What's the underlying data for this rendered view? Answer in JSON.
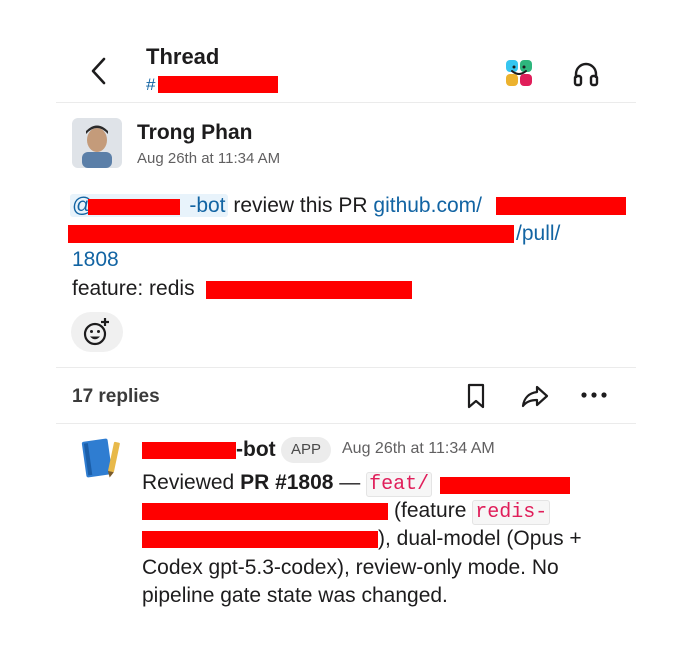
{
  "header": {
    "title": "Thread",
    "channel_prefix": "#"
  },
  "message": {
    "author": "Trong Phan",
    "timestamp": "Aug 26th at 11:34 AM",
    "mention_prefix": "@",
    "mention_suffix": "-bot",
    "text_review": " review this PR ",
    "link_start": "github.com/",
    "link_pull": "/pull/",
    "link_number": "1808",
    "feature_prefix": "feature: redis"
  },
  "thread": {
    "replies_label": "17 replies"
  },
  "reply": {
    "bot_name_suffix": "-bot",
    "badge": "APP",
    "timestamp": "Aug 26th at 11:34 AM",
    "line1_prefix": "Reviewed ",
    "line1_bold": "PR #1808",
    "line1_dash": " — ",
    "line1_code": "feat/",
    "line2_text": " (feature ",
    "line2_code": "redis-",
    "line3_text": "), dual-model (Opus +",
    "line4_text": "Codex gpt-5.3-codex), review-only mode. No",
    "line5_text": "pipeline gate state was changed."
  },
  "colors": {
    "link": "#1264a3",
    "code": "#e01e5a",
    "redaction": "#ff0000"
  },
  "icons": [
    "back-icon",
    "slack-logo-icon",
    "headphones-icon",
    "add-reaction-icon",
    "bookmark-icon",
    "share-icon",
    "more-icon",
    "notebook-icon"
  ]
}
